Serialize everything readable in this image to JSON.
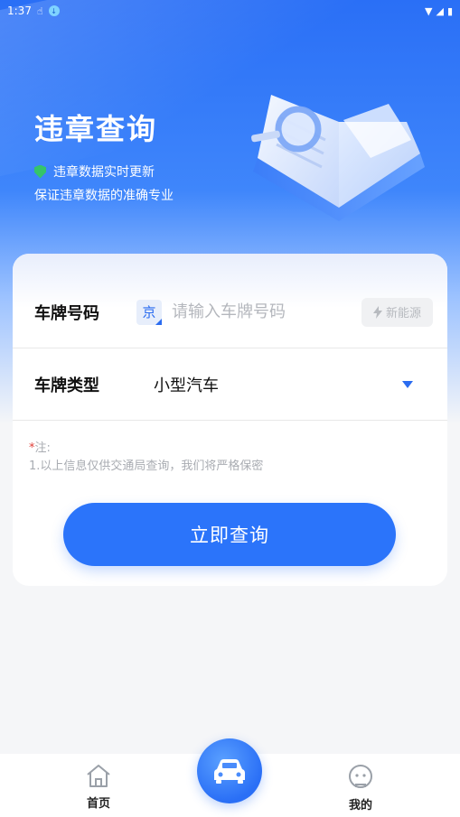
{
  "status_bar": {
    "time": "1:37"
  },
  "hero": {
    "title": "违章查询",
    "line1": "违章数据实时更新",
    "line2": "保证违章数据的准确专业"
  },
  "form": {
    "plate_label": "车牌号码",
    "province": "京",
    "plate_placeholder": "请输入车牌号码",
    "plate_value": "",
    "ev_label": "新能源",
    "type_label": "车牌类型",
    "type_value": "小型汽车",
    "note_title": "注:",
    "note_star": "*",
    "note_line": "1.以上信息仅供交通局查询，我们将严格保密",
    "submit_label": "立即查询"
  },
  "tabbar": {
    "home_label": "首页",
    "mine_label": "我的"
  },
  "colors": {
    "primary": "#2b74fa",
    "hero_top": "#2a6ff6",
    "shield": "#35c46a",
    "required": "#e0403a"
  },
  "icons": [
    "home-icon",
    "car-icon",
    "user-face-icon",
    "shield-check-icon",
    "lightning-icon",
    "dropdown-arrow-icon"
  ]
}
